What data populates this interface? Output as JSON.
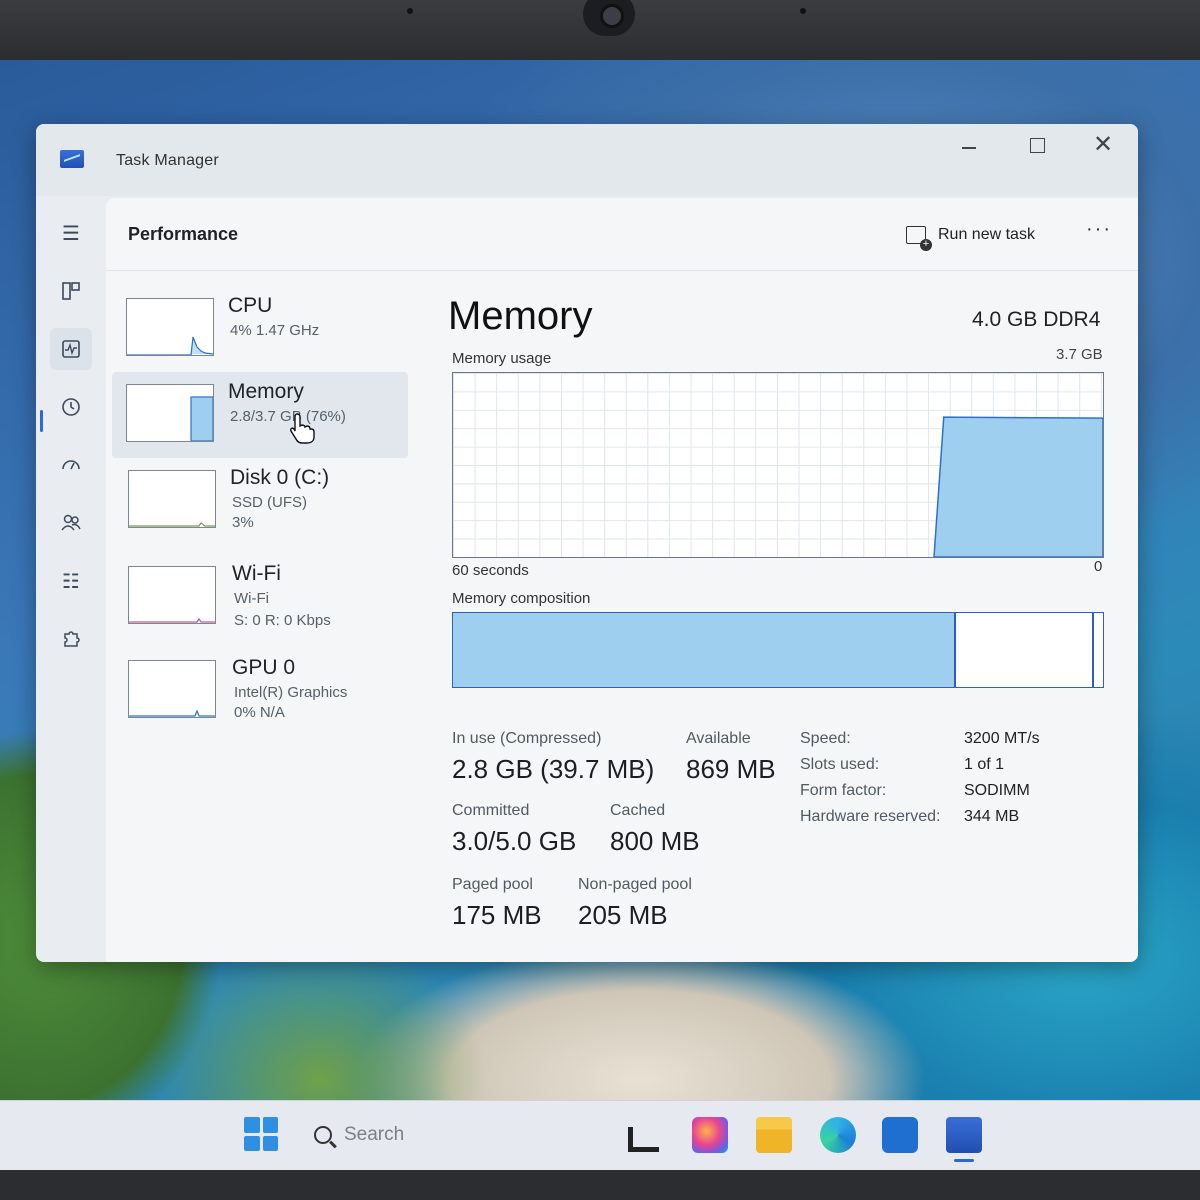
{
  "window": {
    "title": "Task Manager"
  },
  "header": {
    "page_title": "Performance",
    "run_new_task": "Run new task",
    "more": "···"
  },
  "devices": [
    {
      "name": "CPU",
      "line1": "4% 1.47 GHz",
      "line2": ""
    },
    {
      "name": "Memory",
      "line1": "2.8/3.7 GB (76%)",
      "line2": ""
    },
    {
      "name": "Disk 0 (C:)",
      "line1": "SSD (UFS)",
      "line2": "3%"
    },
    {
      "name": "Wi-Fi",
      "line1": "Wi-Fi",
      "line2": "S: 0 R: 0 Kbps"
    },
    {
      "name": "GPU 0",
      "line1": "Intel(R) Graphics",
      "line2": "0% N/A"
    }
  ],
  "memory": {
    "title": "Memory",
    "type": "4.0 GB DDR4",
    "usage_label": "Memory usage",
    "usage_max": "3.7 GB",
    "axis_left": "60 seconds",
    "axis_right": "0",
    "composition_label": "Memory composition",
    "usage_fraction": 0.76,
    "composition": {
      "in_use_fraction": 0.77,
      "standby_fraction": 0.21
    },
    "stats": {
      "in_use_label": "In use (Compressed)",
      "in_use_value": "2.8 GB (39.7 MB)",
      "available_label": "Available",
      "available_value": "869 MB",
      "committed_label": "Committed",
      "committed_value": "3.0/5.0 GB",
      "cached_label": "Cached",
      "cached_value": "800 MB",
      "paged_label": "Paged pool",
      "paged_value": "175 MB",
      "nonpaged_label": "Non-paged pool",
      "nonpaged_value": "205 MB"
    },
    "specs": [
      {
        "key": "Speed:",
        "value": "3200 MT/s"
      },
      {
        "key": "Slots used:",
        "value": "1 of 1"
      },
      {
        "key": "Form factor:",
        "value": "SODIMM"
      },
      {
        "key": "Hardware reserved:",
        "value": "344 MB"
      }
    ]
  },
  "taskbar": {
    "search_placeholder": "Search"
  },
  "colors": {
    "accent": "#2e5fc0",
    "graph_fill": "#9fcfee",
    "graph_line": "#2e6fd0"
  }
}
